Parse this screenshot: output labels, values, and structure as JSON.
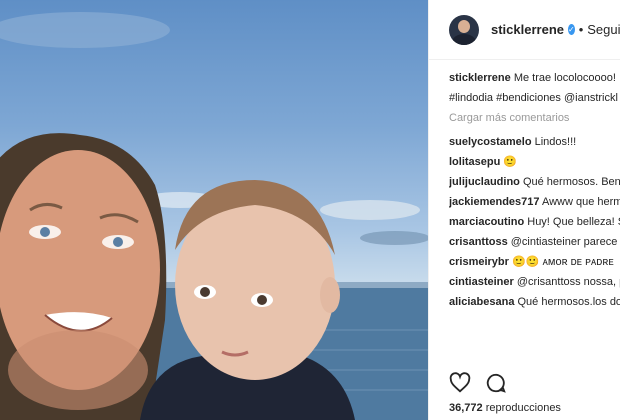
{
  "post": {
    "username": "sticklerrene",
    "verified_icon": "verified-badge-icon",
    "separator": "•",
    "follow_status": "Seguido"
  },
  "caption": {
    "username": "stickl­errene",
    "text": "Me trae locolocoooo!",
    "hashtags": "#lindodia #bendiciones @ianstrickl"
  },
  "load_more": "Cargar más comentarios",
  "comments": [
    {
      "user": "suelycostamelo",
      "text": "Lindos!!!"
    },
    {
      "user": "lolitasepu",
      "text": "🙂"
    },
    {
      "user": "julijuclaudino",
      "text": "Qué hermosos. Bend desde Brasil"
    },
    {
      "user": "jackiemendes717",
      "text": "Awww que herm 🙂"
    },
    {
      "user": "marciacoutino",
      "text": "Huy! Que belleza! S toda la familia! Los queremos!"
    },
    {
      "user": "crisanttoss",
      "text": "@cintiasteiner parece o 😊"
    },
    {
      "user": "crismeirybr",
      "text": "🙂🙂 ᴀᴍᴏʀ ᴅᴇ ᴘᴀᴅʀᴇ"
    },
    {
      "user": "cintiasteiner",
      "text": "@crisanttoss nossa, p mesmo! 🙂♥"
    },
    {
      "user": "aliciabesana",
      "text": "Qué hermosos.los do"
    }
  ],
  "actions": {
    "like_icon": "heart-icon",
    "comment_icon": "comment-icon"
  },
  "views": {
    "count": "36,772",
    "label": "reproducciones"
  }
}
